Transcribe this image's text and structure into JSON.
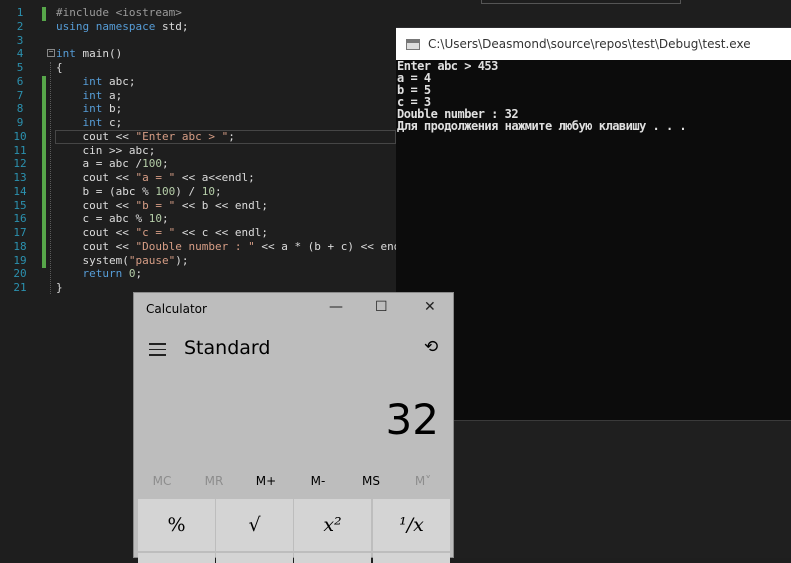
{
  "editor": {
    "line_numbers": [
      "1",
      "2",
      "3",
      "4",
      "5",
      "6",
      "7",
      "8",
      "9",
      "10",
      "11",
      "12",
      "13",
      "14",
      "15",
      "16",
      "17",
      "18",
      "19",
      "20",
      "21"
    ],
    "lines": [
      [
        [
          "#include <iostream>",
          "pp"
        ]
      ],
      [
        [
          "using ",
          "kw"
        ],
        [
          "namespace ",
          "kw"
        ],
        [
          "std;",
          "txt"
        ]
      ],
      [],
      [
        [
          "int ",
          "kw"
        ],
        [
          "main()",
          "txt"
        ]
      ],
      [
        [
          "{",
          "txt"
        ]
      ],
      [
        [
          "    ",
          "txt"
        ],
        [
          "int ",
          "kw"
        ],
        [
          "abc;",
          "txt"
        ]
      ],
      [
        [
          "    ",
          "txt"
        ],
        [
          "int ",
          "kw"
        ],
        [
          "a;",
          "txt"
        ]
      ],
      [
        [
          "    ",
          "txt"
        ],
        [
          "int ",
          "kw"
        ],
        [
          "b;",
          "txt"
        ]
      ],
      [
        [
          "    ",
          "txt"
        ],
        [
          "int ",
          "kw"
        ],
        [
          "c;",
          "txt"
        ]
      ],
      [
        [
          "    cout << ",
          "txt"
        ],
        [
          "\"Enter abc > \"",
          "str"
        ],
        [
          ";",
          "txt"
        ]
      ],
      [
        [
          "    cin >> abc;",
          "txt"
        ]
      ],
      [
        [
          "    a = abc /",
          "txt"
        ],
        [
          "100",
          "num"
        ],
        [
          ";",
          "txt"
        ]
      ],
      [
        [
          "    cout << ",
          "txt"
        ],
        [
          "\"a = \"",
          "str"
        ],
        [
          " << a<<endl;",
          "txt"
        ]
      ],
      [
        [
          "    b = (abc % ",
          "txt"
        ],
        [
          "100",
          "num"
        ],
        [
          ") / ",
          "txt"
        ],
        [
          "10",
          "num"
        ],
        [
          ";",
          "txt"
        ]
      ],
      [
        [
          "    cout << ",
          "txt"
        ],
        [
          "\"b = \"",
          "str"
        ],
        [
          " << b << endl;",
          "txt"
        ]
      ],
      [
        [
          "    c = abc % ",
          "txt"
        ],
        [
          "10",
          "num"
        ],
        [
          ";",
          "txt"
        ]
      ],
      [
        [
          "    cout << ",
          "txt"
        ],
        [
          "\"c = \"",
          "str"
        ],
        [
          " << c << endl;",
          "txt"
        ]
      ],
      [
        [
          "    cout << ",
          "txt"
        ],
        [
          "\"Double number : \"",
          "str"
        ],
        [
          " << a * (b + c) << endl;",
          "txt"
        ]
      ],
      [
        [
          "    system(",
          "txt"
        ],
        [
          "\"pause\"",
          "str"
        ],
        [
          ");",
          "txt"
        ]
      ],
      [
        [
          "    ",
          "txt"
        ],
        [
          "return ",
          "kw"
        ],
        [
          "0",
          "num"
        ],
        [
          ";",
          "txt"
        ]
      ],
      [
        [
          "}",
          "txt"
        ]
      ]
    ]
  },
  "console": {
    "title": "C:\\Users\\Deasmond\\source\\repos\\test\\Debug\\test.exe",
    "lines": [
      "Enter abc > 453",
      "a = 4",
      "b = 5",
      "c = 3",
      "Double number : 32",
      "Для продолжения нажмите любую клавишу . . ."
    ]
  },
  "calculator": {
    "title": "Calculator",
    "mode": "Standard",
    "display": "32",
    "window_buttons": {
      "minimize": "—",
      "maximize": "☐",
      "close": "✕"
    },
    "memory": [
      "MC",
      "MR",
      "M+",
      "M-",
      "MS",
      "M˅"
    ],
    "buttons": [
      "%",
      "√",
      "x²",
      "¹/x"
    ]
  }
}
